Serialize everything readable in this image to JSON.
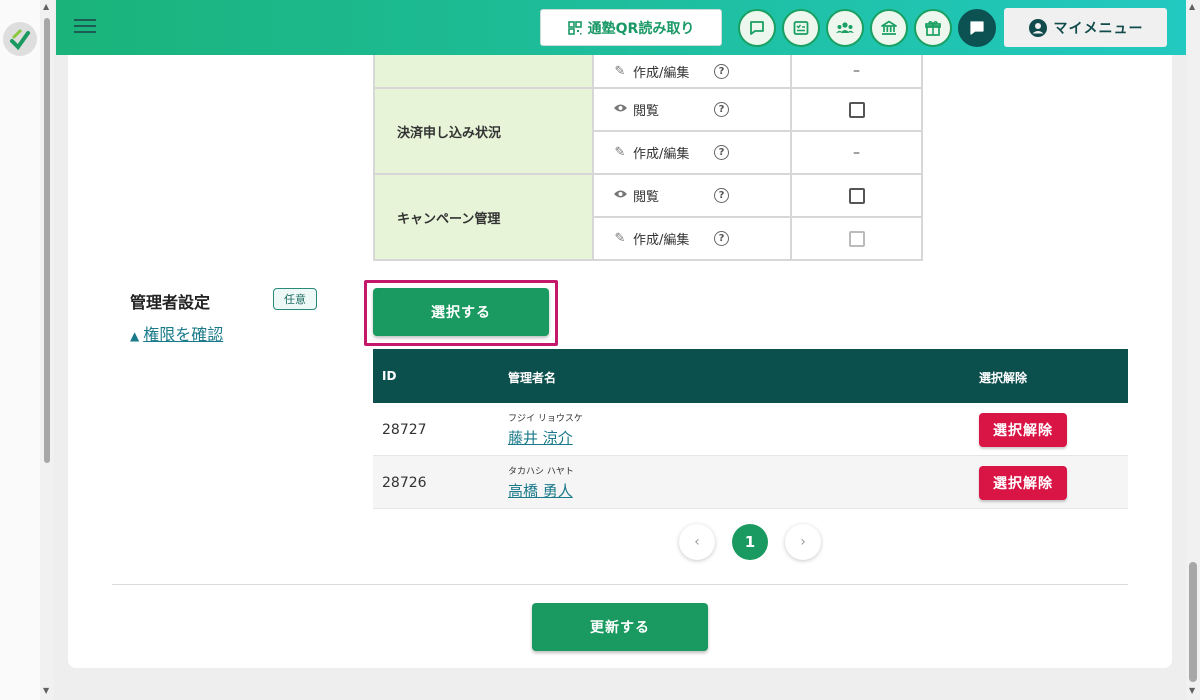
{
  "header": {
    "qr_button_label": "通塾QR読み取り",
    "icons": [
      "chat-icon",
      "checklist-icon",
      "group-icon",
      "institution-icon",
      "gift-icon",
      "message-icon"
    ],
    "my_menu_label": "マイメニュー"
  },
  "permissions": {
    "rows": [
      {
        "category": "",
        "items": [
          {
            "icon": "pencil-icon",
            "label": "作成/編集",
            "value": "–"
          }
        ]
      },
      {
        "category": "決済申し込み状況",
        "items": [
          {
            "icon": "eye-icon",
            "label": "閲覧",
            "value": "checkbox"
          },
          {
            "icon": "pencil-icon",
            "label": "作成/編集",
            "value": "–"
          }
        ]
      },
      {
        "category": "キャンペーン管理",
        "items": [
          {
            "icon": "eye-icon",
            "label": "閲覧",
            "value": "checkbox"
          },
          {
            "icon": "pencil-icon",
            "label": "作成/編集",
            "value": "checkbox-disabled"
          }
        ]
      }
    ],
    "labels": {
      "r0_edit": "作成/編集",
      "r1_cat": "決済申し込み状況",
      "r1_view": "閲覧",
      "r1_edit": "作成/編集",
      "r2_cat": "キャンペーン管理",
      "r2_view": "閲覧",
      "r2_edit": "作成/編集",
      "dash": "–",
      "help": "?"
    }
  },
  "admin": {
    "title": "管理者設定",
    "badge": "任意",
    "check_link": "権限を確認",
    "select_button": "選択する",
    "table": {
      "headers": {
        "id": "ID",
        "name": "管理者名",
        "deselect": "選択解除"
      },
      "rows": [
        {
          "id": "28727",
          "kana": "フジイ リョウスケ",
          "name": "藤井 涼介",
          "action": "選択解除"
        },
        {
          "id": "28726",
          "kana": "タカハシ ハヤト",
          "name": "高橋 勇人",
          "action": "選択解除"
        }
      ]
    },
    "pagination": {
      "prev": "‹",
      "current": "1",
      "next": "›"
    }
  },
  "footer": {
    "update_button": "更新する"
  },
  "colors": {
    "primary": "#1a9a60",
    "header_dark": "#0c504e",
    "danger": "#d91546",
    "highlight": "#c4186a",
    "category_bg": "#e7f4d8"
  }
}
